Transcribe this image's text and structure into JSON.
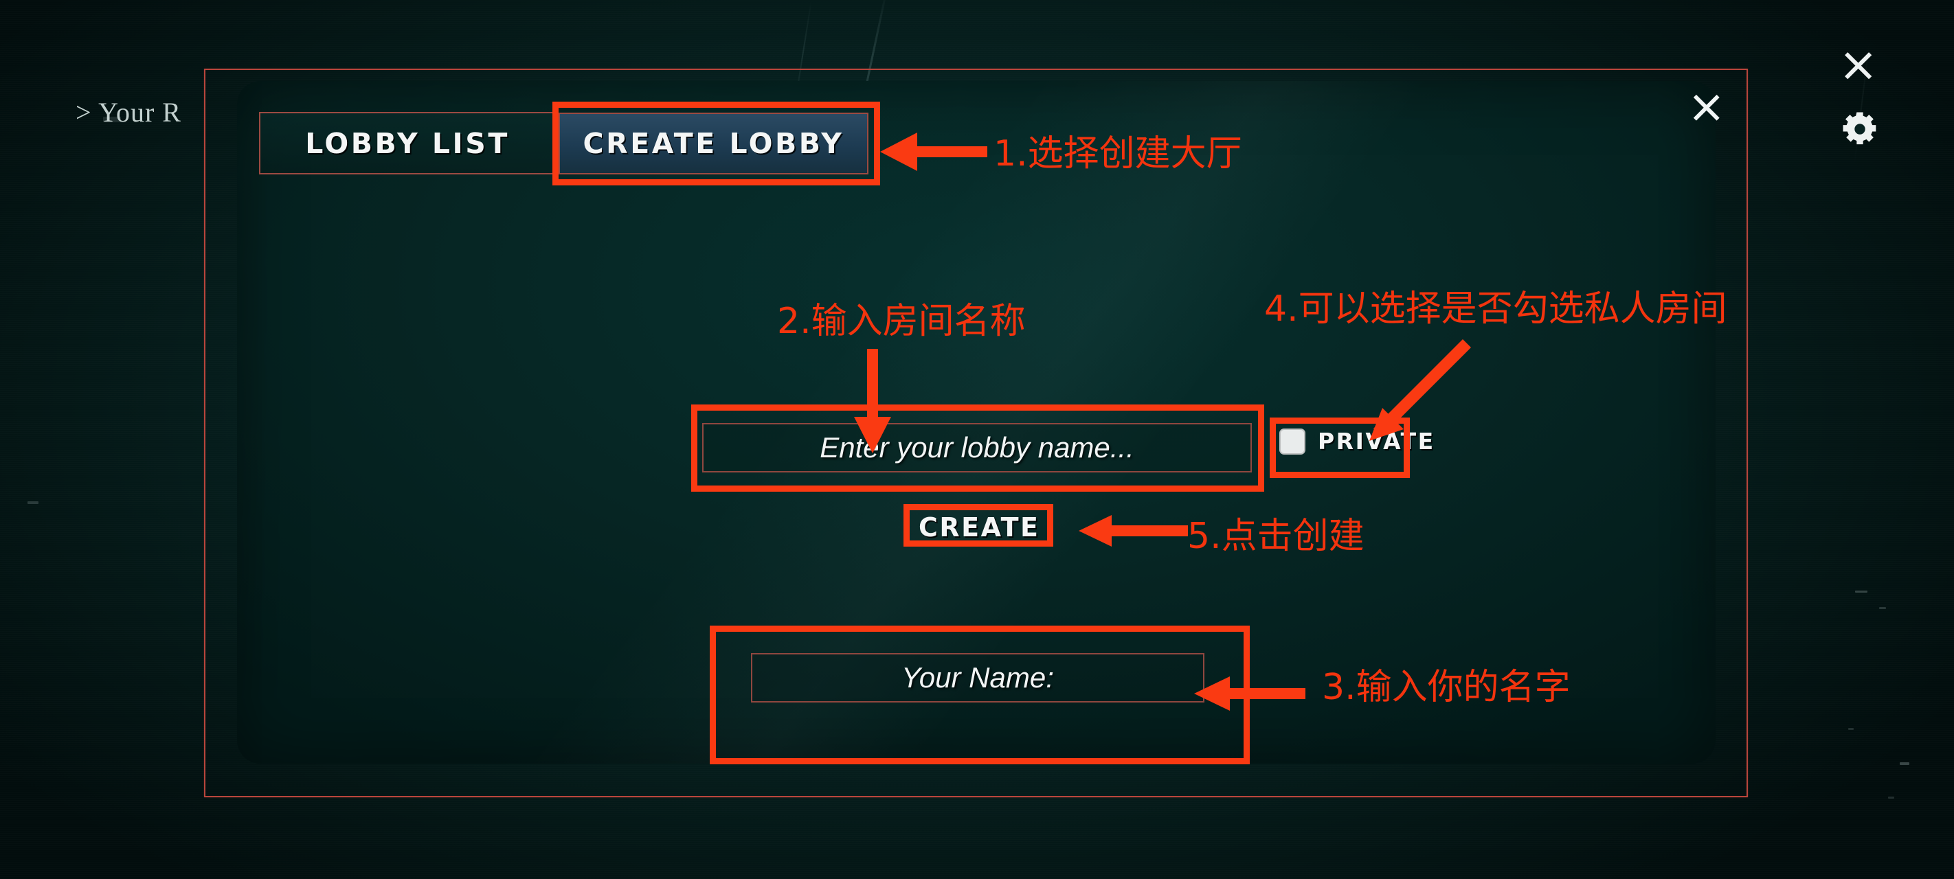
{
  "background": {
    "hud_text": "> Your R"
  },
  "window_controls": {
    "close_icon": "close-icon",
    "settings_icon": "gear-icon"
  },
  "modal": {
    "close_icon": "close-icon",
    "tabs": [
      {
        "label": "LOBBY LIST",
        "selected": false
      },
      {
        "label": "CREATE LOBBY",
        "selected": true
      }
    ],
    "lobby_name_field": {
      "placeholder": "Enter your lobby name...",
      "value": ""
    },
    "private_checkbox": {
      "label": "PRIVATE",
      "checked": false
    },
    "create_button": {
      "label": "CREATE"
    },
    "your_name_field": {
      "placeholder": "Your Name:",
      "value": ""
    }
  },
  "annotations": {
    "accent_color": "#fa3a12",
    "items": [
      {
        "id": 1,
        "text": "1.选择创建大厅"
      },
      {
        "id": 2,
        "text": "2.输入房间名称"
      },
      {
        "id": 3,
        "text": "3.输入你的名字"
      },
      {
        "id": 4,
        "text": "4.可以选择是否勾选私人房间"
      },
      {
        "id": 5,
        "text": "5.点击创建"
      }
    ]
  },
  "colors": {
    "panel_bg": "#062624",
    "tab_selected": "#2b4a63",
    "frame_border": "#b8453c",
    "annotation_red": "#fa3a12",
    "text_white": "#f4f6f6"
  }
}
